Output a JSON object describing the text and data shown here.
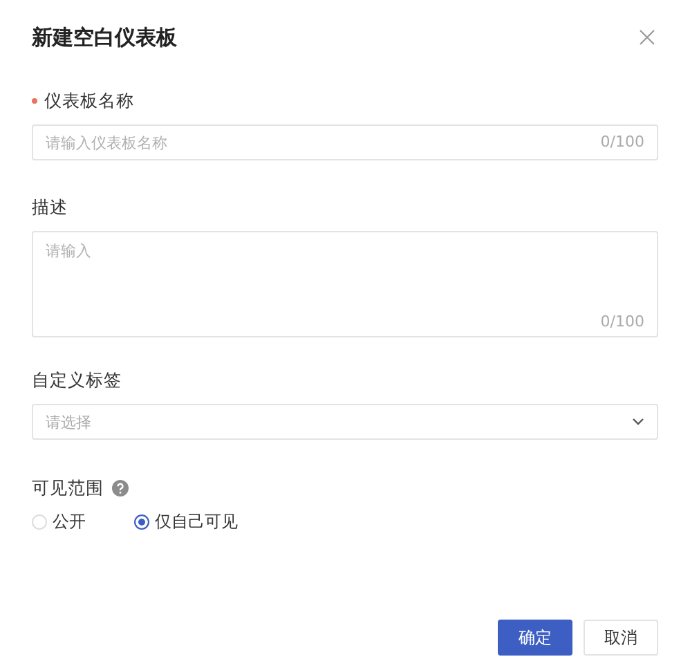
{
  "dialog": {
    "title": "新建空白仪表板"
  },
  "name_field": {
    "label": "仪表板名称",
    "required": true,
    "placeholder": "请输入仪表板名称",
    "counter": "0/100"
  },
  "description_field": {
    "label": "描述",
    "placeholder": "请输入",
    "counter": "0/100"
  },
  "tags_field": {
    "label": "自定义标签",
    "placeholder": "请选择"
  },
  "visibility": {
    "label": "可见范围",
    "options": [
      {
        "label": "公开",
        "selected": false
      },
      {
        "label": "仅自己可见",
        "selected": true
      }
    ]
  },
  "buttons": [
    {
      "label": "确定",
      "kind": "primary"
    },
    {
      "label": "取消",
      "kind": "default"
    }
  ]
}
